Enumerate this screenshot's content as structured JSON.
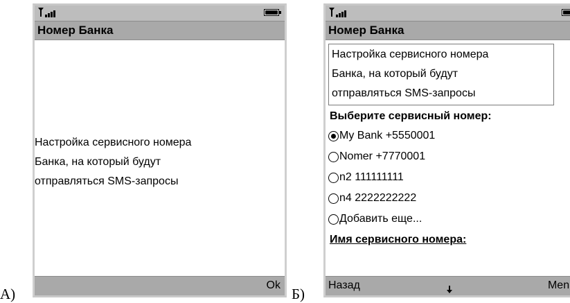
{
  "labels": {
    "a": "А)",
    "b": "Б)"
  },
  "screen_a": {
    "title": "Номер Банка",
    "description": [
      "Настройка сервисного номера",
      "Банка, на который будут",
      "отправляться SMS-запросы"
    ],
    "softkeys": {
      "right": "Ok"
    },
    "battery_level": 1.0
  },
  "screen_b": {
    "title": "Номер Банка",
    "description": [
      "Настройка сервисного номера",
      "Банка, на который будут",
      "отправляться SMS-запросы"
    ],
    "select_label": "Выберите сервисный номер:",
    "options": [
      {
        "label": "My Bank +5550001",
        "checked": true
      },
      {
        "label": "Nomer +7770001",
        "checked": false
      },
      {
        "label": "n2 111111111",
        "checked": false
      },
      {
        "label": "n4 2222222222",
        "checked": false
      },
      {
        "label": "Добавить еще...",
        "checked": false
      }
    ],
    "name_label": "Имя сервисного номера:",
    "softkeys": {
      "left": "Назад",
      "middle_icon": "arrow-down-icon",
      "right": "Menu"
    },
    "battery_level": 1.0
  }
}
